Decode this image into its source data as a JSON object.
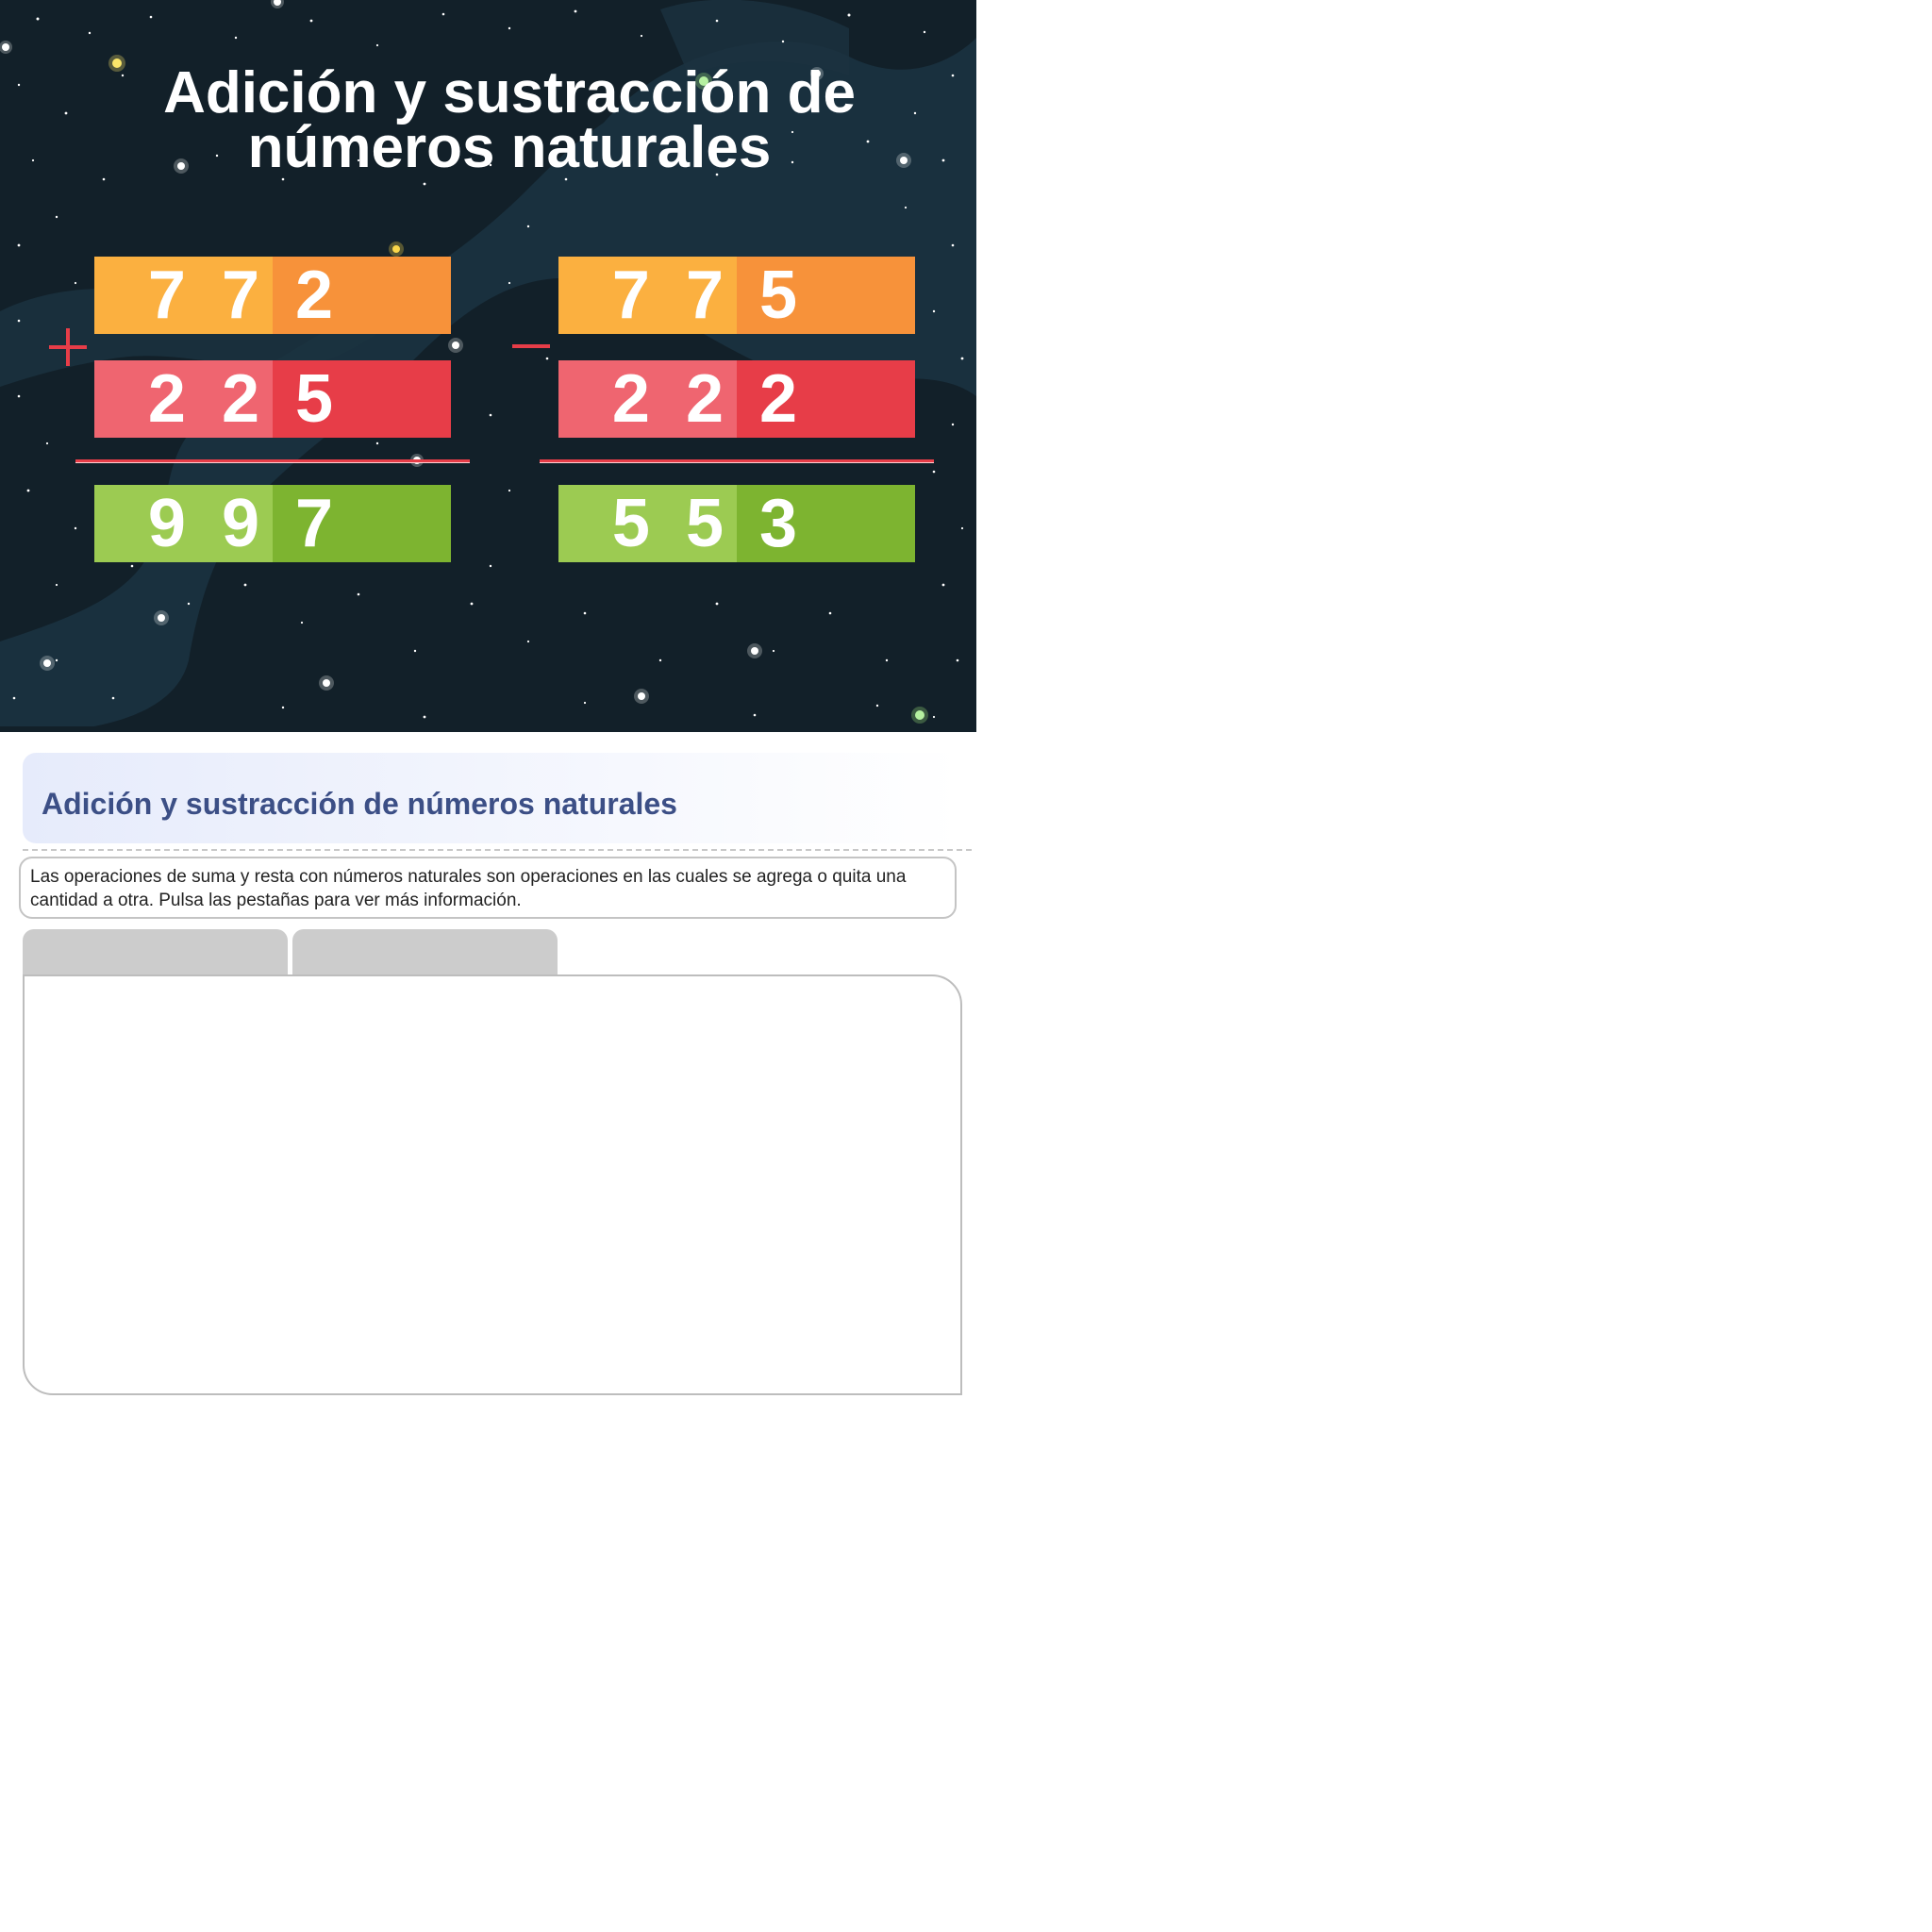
{
  "banner": {
    "title": "Adición y sustracción de números naturales",
    "addition": {
      "operator": "+",
      "top": [
        "7",
        "7",
        "2"
      ],
      "bottom": [
        "2",
        "2",
        "5"
      ],
      "result": [
        "9",
        "9",
        "7"
      ]
    },
    "subtraction": {
      "operator": "−",
      "top": [
        "7",
        "7",
        "5"
      ],
      "bottom": [
        "2",
        "2",
        "2"
      ],
      "result": [
        "5",
        "5",
        "3"
      ]
    }
  },
  "section": {
    "title": "Adición y sustracción de números naturales",
    "intro": "Las operaciones de suma y resta con números naturales son operaciones en las cuales se agrega o quita una cantidad a otra. Pulsa las pestañas para ver más información."
  },
  "tabs": [
    {
      "label": ""
    },
    {
      "label": ""
    }
  ],
  "colors": {
    "banner_bg": "#122029",
    "orange": "#f7923a",
    "red": "#e73d48",
    "green": "#7db430",
    "title_blue": "#3c4f86"
  }
}
